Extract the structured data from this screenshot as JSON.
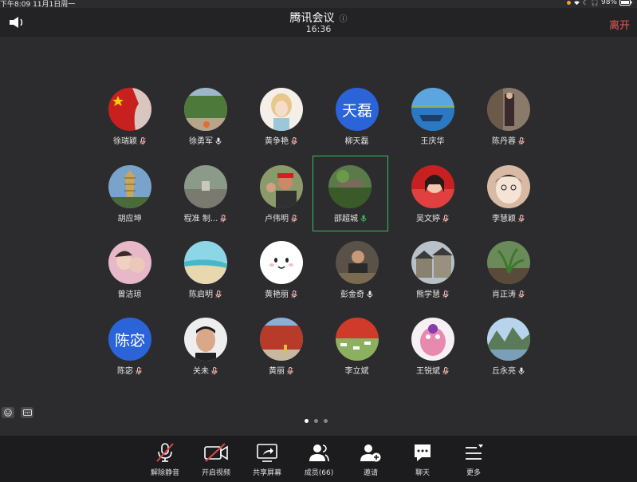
{
  "status": {
    "time_date": "下午8:09   11月1日周一",
    "battery": "98%"
  },
  "header": {
    "title": "腾讯会议",
    "duration": "16:36",
    "leave_label": "离开"
  },
  "participants": [
    {
      "name": "徐瑞颖",
      "mic": "muted",
      "avatar": "flag"
    },
    {
      "name": "徐勇军",
      "mic": "on",
      "avatar": "trees"
    },
    {
      "name": "黄争艳",
      "mic": "muted",
      "avatar": "girl-drawing"
    },
    {
      "name": "柳天磊",
      "mic": "none",
      "avatar": "text",
      "avatar_text": "天磊",
      "color": "#2b63d9"
    },
    {
      "name": "王庆华",
      "mic": "none",
      "avatar": "boat"
    },
    {
      "name": "陈丹蓉",
      "mic": "muted",
      "avatar": "woman"
    },
    {
      "name": "胡应坤",
      "mic": "none",
      "avatar": "pagoda"
    },
    {
      "name": "程准 制...",
      "mic": "muted",
      "avatar": "courtyard"
    },
    {
      "name": "卢伟明",
      "mic": "muted",
      "avatar": "man-cap"
    },
    {
      "name": "邵超城",
      "mic": "active",
      "avatar": "garden",
      "active": true
    },
    {
      "name": "吴文婷",
      "mic": "muted",
      "avatar": "girl-flag"
    },
    {
      "name": "李慧颖",
      "mic": "muted",
      "avatar": "cartoon"
    },
    {
      "name": "曾洁琼",
      "mic": "none",
      "avatar": "couple"
    },
    {
      "name": "陈启明",
      "mic": "muted",
      "avatar": "beach"
    },
    {
      "name": "黄艳丽",
      "mic": "muted",
      "avatar": "smile"
    },
    {
      "name": "彭金奇",
      "mic": "on",
      "avatar": "man-desk"
    },
    {
      "name": "熊学慧",
      "mic": "muted",
      "avatar": "houses"
    },
    {
      "name": "肖正涛",
      "mic": "muted",
      "avatar": "plant"
    },
    {
      "name": "陈宓",
      "mic": "muted",
      "avatar": "text",
      "avatar_text": "陈宓",
      "color": "#2b63d9"
    },
    {
      "name": "关未",
      "mic": "muted",
      "avatar": "man-face"
    },
    {
      "name": "黄丽",
      "mic": "muted",
      "avatar": "wall"
    },
    {
      "name": "李立斌",
      "mic": "none",
      "avatar": "field-flag"
    },
    {
      "name": "王锐斌",
      "mic": "muted",
      "avatar": "pink-toy"
    },
    {
      "name": "丘永亮",
      "mic": "on",
      "avatar": "mountains"
    }
  ],
  "toolbar": [
    {
      "id": "unmute",
      "label": "解除静音",
      "icon": "mic-off-icon"
    },
    {
      "id": "video",
      "label": "开启视频",
      "icon": "camera-off-icon"
    },
    {
      "id": "share",
      "label": "共享屏幕",
      "icon": "share-screen-icon"
    },
    {
      "id": "members",
      "label": "成员(66)",
      "icon": "members-icon"
    },
    {
      "id": "invite",
      "label": "邀请",
      "icon": "invite-icon"
    },
    {
      "id": "chat",
      "label": "聊天",
      "icon": "chat-icon"
    },
    {
      "id": "more",
      "label": "更多",
      "icon": "more-icon"
    }
  ],
  "pager": {
    "pages": 3,
    "current": 1
  }
}
